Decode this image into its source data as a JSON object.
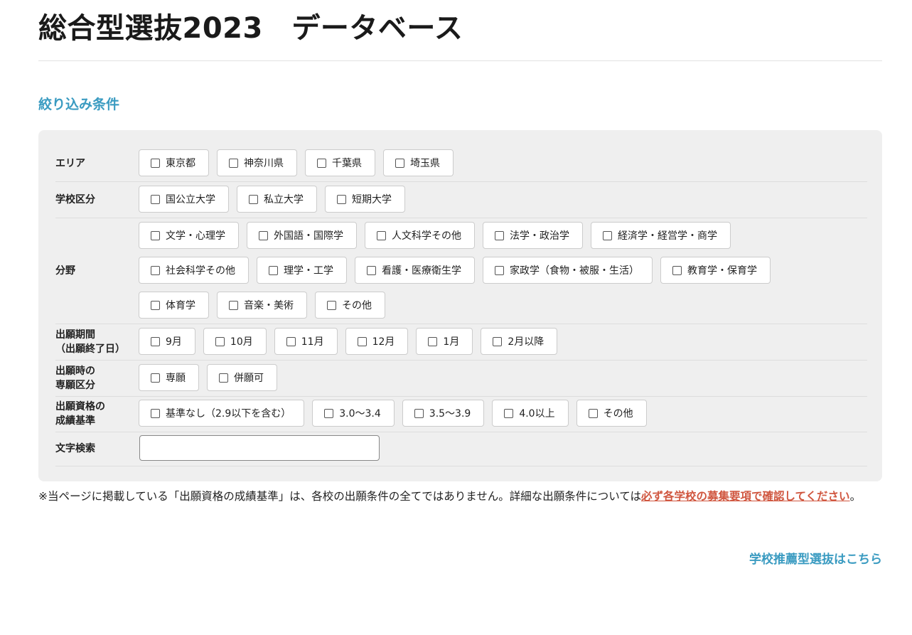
{
  "page": {
    "title": "総合型選抜2023　データベース"
  },
  "filter": {
    "heading": "絞り込み条件",
    "rows": [
      {
        "label": [
          "エリア"
        ],
        "lines": [
          [
            "東京都",
            "神奈川県",
            "千葉県",
            "埼玉県"
          ]
        ]
      },
      {
        "label": [
          "学校区分"
        ],
        "lines": [
          [
            "国公立大学",
            "私立大学",
            "短期大学"
          ]
        ]
      },
      {
        "label": [
          "分野"
        ],
        "lines": [
          [
            "文学・心理学",
            "外国語・国際学",
            "人文科学その他",
            "法学・政治学",
            "経済学・経営学・商学"
          ],
          [
            "社会科学その他",
            "理学・工学",
            "看護・医療衛生学",
            "家政学（食物・被服・生活）",
            "教育学・保育学"
          ],
          [
            "体育学",
            "音楽・美術",
            "その他"
          ]
        ]
      },
      {
        "label": [
          "出願期間",
          "（出願終了日）"
        ],
        "lines": [
          [
            "9月",
            "10月",
            "11月",
            "12月",
            "1月",
            "2月以降"
          ]
        ]
      },
      {
        "label": [
          "出願時の",
          "専願区分"
        ],
        "lines": [
          [
            "専願",
            "併願可"
          ]
        ]
      },
      {
        "label": [
          "出願資格の",
          "成績基準"
        ],
        "lines": [
          [
            "基準なし（2.9以下を含む）",
            "3.0〜3.4",
            "3.5〜3.9",
            "4.0以上",
            "その他"
          ]
        ]
      }
    ],
    "search": {
      "label": "文字検索",
      "value": "",
      "placeholder": ""
    }
  },
  "notice": {
    "text_before": "※当ページに掲載している「出願資格の成績基準」は、各校の出願条件の全てではありません。詳細な出願条件については",
    "emphasis": "必ず各学校の募集要項で確認してください",
    "text_after": "。"
  },
  "links": {
    "school_recommendation": "学校推薦型選抜はこちら"
  },
  "colors": {
    "accent": "#3a9bc1",
    "warning": "#d0563f",
    "panel_bg": "#efefef"
  }
}
